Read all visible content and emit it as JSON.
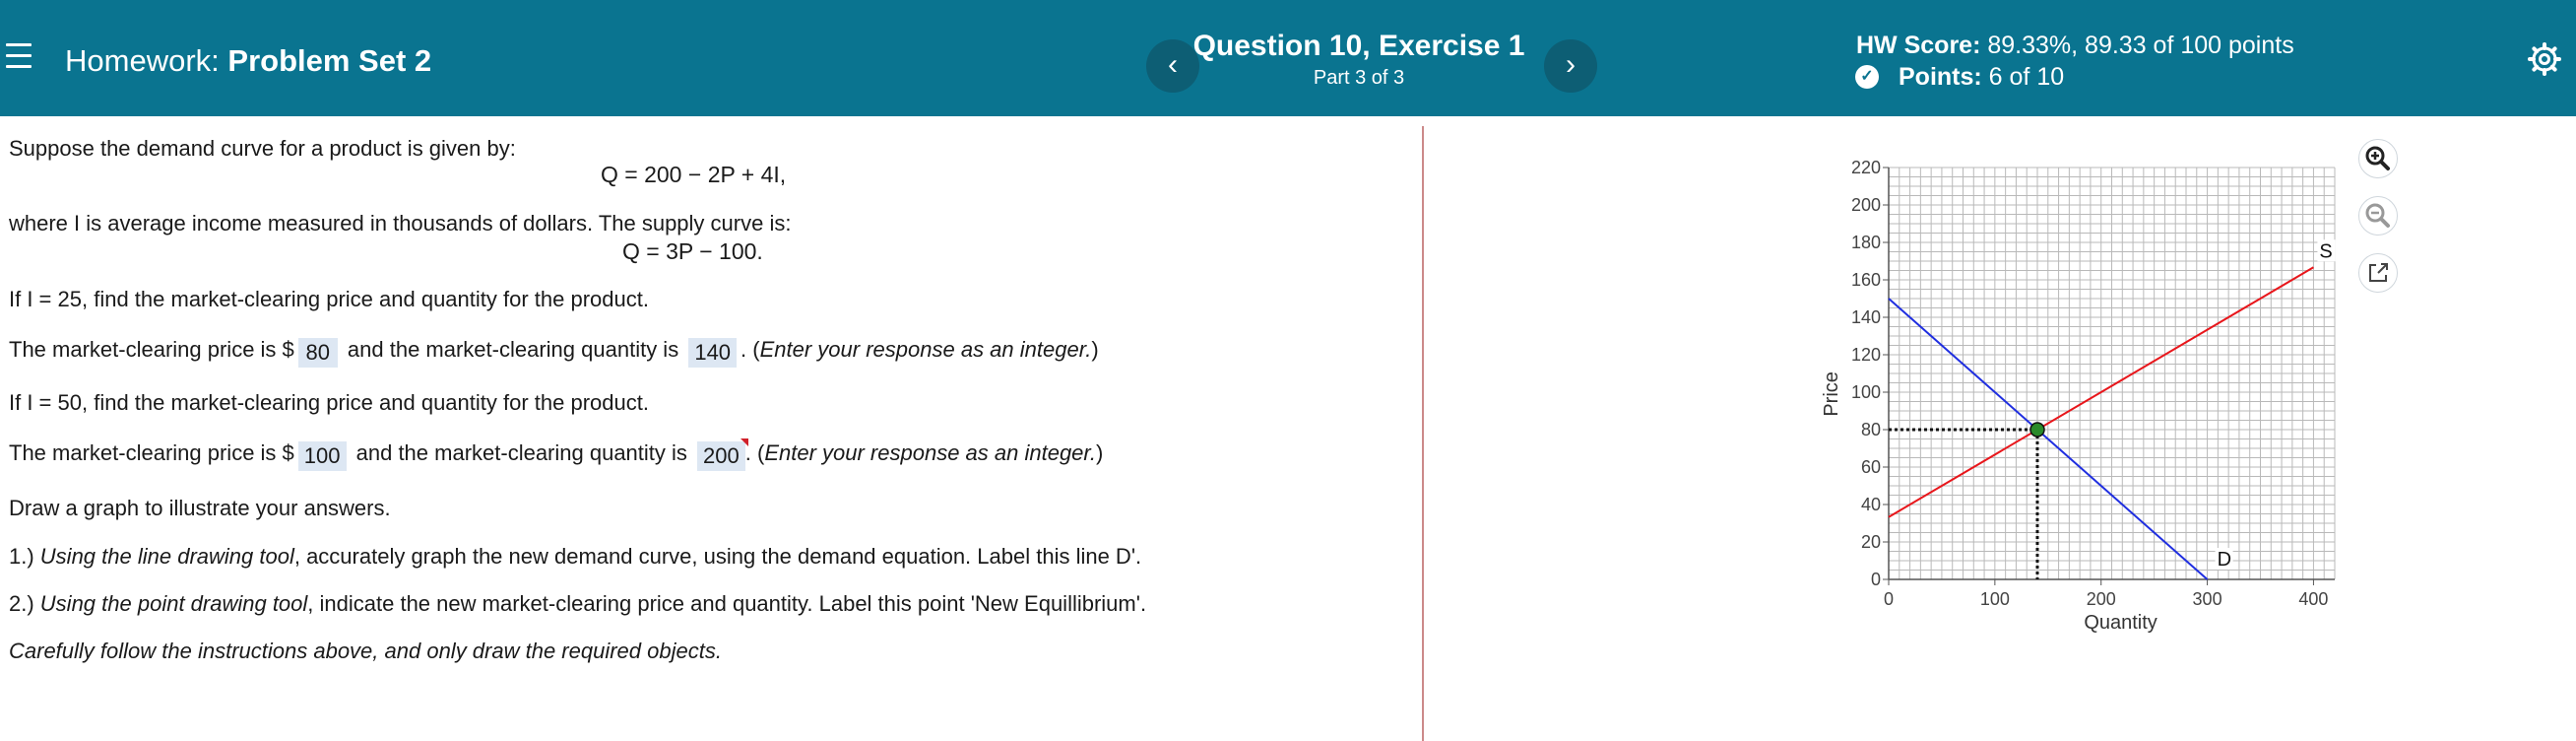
{
  "header": {
    "homework_label": "Homework:",
    "homework_name": "Problem Set 2",
    "question_title": "Question 10, Exercise 1",
    "question_part": "Part 3 of 3",
    "prev_label": "‹",
    "next_label": "›",
    "hw_score_label": "HW Score:",
    "hw_score_value": "89.33%, 89.33 of 100 points",
    "points_label": "Points:",
    "points_value": "6 of 10"
  },
  "problem": {
    "intro": "Suppose the demand curve for a product is given by:",
    "demand_eq": "Q = 200 − 2P + 4I,",
    "income_note": "where I is average income measured in thousands of dollars. The supply curve is:",
    "supply_eq": "Q = 3P − 100.",
    "q1": "If I = 25, find the market-clearing price and quantity for the product.",
    "a1_prefix": "The market-clearing price is $",
    "a1_price": "80",
    "a1_mid": "and the market-clearing quantity is",
    "a1_qty": "140",
    "a1_suffix_plain": ". (",
    "a1_suffix_italic": "Enter your response as an integer.",
    "a1_close": ")",
    "q2": "If I = 50, find the market-clearing price and quantity for the product.",
    "a2_prefix": "The market-clearing price is $",
    "a2_price": "100",
    "a2_mid": "and the market-clearing quantity is",
    "a2_qty": "200",
    "a2_suffix_plain": ". (",
    "a2_suffix_italic": "Enter your response as an integer.",
    "a2_close": ")",
    "draw": "Draw a graph to illustrate your answers.",
    "step1_num": "1.) ",
    "step1_italic": "Using the line drawing tool",
    "step1_rest": ", accurately graph the new demand curve, using the demand equation. Label this line D'.",
    "step2_num": "2.) ",
    "step2_italic": "Using the point drawing tool",
    "step2_rest": ", indicate the new market-clearing price and quantity. Label this point 'New Equillibrium'.",
    "note": "Carefully follow the instructions above, and only draw the required objects."
  },
  "tools": {
    "zoom_in": "zoom-in-icon",
    "zoom_out": "zoom-out-icon",
    "expand": "external-link-icon"
  },
  "chart_data": {
    "type": "line",
    "xlabel": "Quantity",
    "ylabel": "Price",
    "xlim": [
      0,
      420
    ],
    "ylim": [
      0,
      220
    ],
    "x_ticks": [
      0,
      100,
      200,
      300,
      400
    ],
    "y_ticks": [
      0,
      20,
      40,
      60,
      80,
      100,
      120,
      140,
      160,
      180,
      200,
      220
    ],
    "grid": true,
    "series": [
      {
        "name": "S",
        "color": "#e8161b",
        "points": [
          [
            0,
            33.3
          ],
          [
            400,
            166.7
          ]
        ]
      },
      {
        "name": "D",
        "color": "#1f2ee0",
        "points": [
          [
            0,
            150
          ],
          [
            300,
            0
          ]
        ]
      }
    ],
    "equilibrium": {
      "x": 140,
      "y": 80,
      "color": "#2a8a2a"
    }
  }
}
